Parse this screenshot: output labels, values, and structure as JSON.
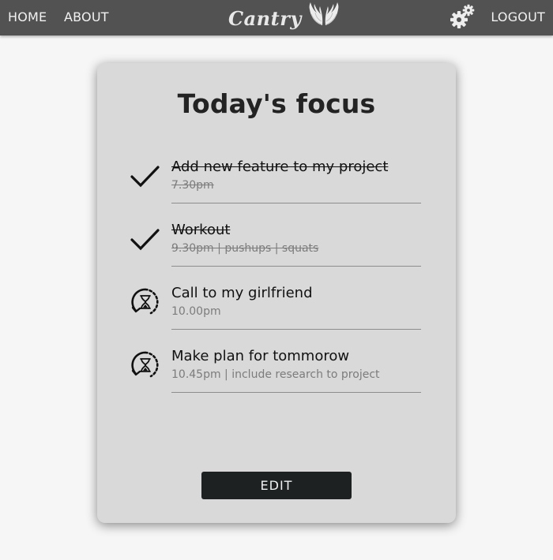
{
  "nav": {
    "home": "HOME",
    "about": "ABOUT",
    "brand": "Cantry",
    "logout": "LOGOUT",
    "brand_logo_icon": "angel-wings-icon",
    "settings_icon": "gears-icon"
  },
  "card": {
    "title": "Today's focus",
    "edit_label": "EDIT",
    "tasks": [
      {
        "title": "Add new feature to my project",
        "meta": "7.30pm",
        "status": "done",
        "icon": "checkmark-icon"
      },
      {
        "title": "Workout",
        "meta": "9.30pm | pushups | squats",
        "status": "done",
        "icon": "checkmark-icon"
      },
      {
        "title": "Call to my girlfriend",
        "meta": "10.00pm",
        "status": "pending",
        "icon": "hourglass-timer-icon"
      },
      {
        "title": "Make plan for tommorow",
        "meta": "10.45pm | include research to project",
        "status": "pending",
        "icon": "hourglass-timer-icon"
      }
    ]
  },
  "colors": {
    "navbar_bg": "#525252",
    "page_bg": "#f6f6f6",
    "card_bg": "#d9d9d9",
    "button_bg": "#1e2122"
  }
}
